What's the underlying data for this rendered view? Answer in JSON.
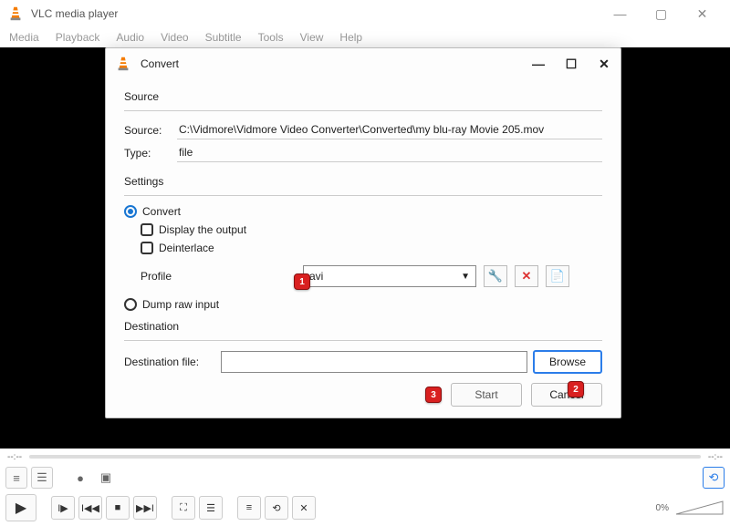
{
  "main": {
    "title": "VLC media player",
    "menubar": [
      "Media",
      "Playback",
      "Audio",
      "Video",
      "Subtitle",
      "Tools",
      "View",
      "Help"
    ],
    "time_left": "--:--",
    "time_right": "--:--",
    "volume_pct": "0%"
  },
  "dialog": {
    "title": "Convert",
    "source": {
      "section": "Source",
      "source_label": "Source:",
      "source_value": "C:\\Vidmore\\Vidmore Video Converter\\Converted\\my blu-ray Movie 205.mov",
      "type_label": "Type:",
      "type_value": "file"
    },
    "settings": {
      "section": "Settings",
      "convert_label": "Convert",
      "display_output_label": "Display the output",
      "deinterlace_label": "Deinterlace",
      "profile_label": "Profile",
      "profile_value": "avi",
      "dump_label": "Dump raw input"
    },
    "destination": {
      "section": "Destination",
      "file_label": "Destination file:",
      "file_value": "",
      "browse_label": "Browse"
    },
    "buttons": {
      "start": "Start",
      "cancel": "Cancel"
    }
  },
  "badges": {
    "b1": "1",
    "b2": "2",
    "b3": "3"
  }
}
